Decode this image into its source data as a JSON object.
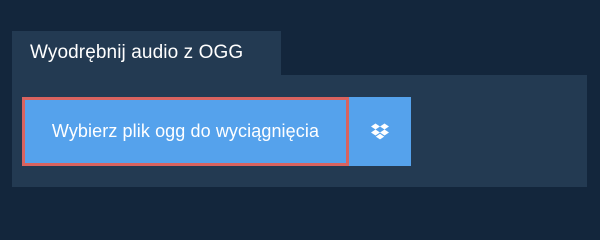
{
  "tab": {
    "label": "Wyodrębnij audio z OGG"
  },
  "actions": {
    "pick_file_label": "Wybierz plik ogg do wyciągnięcia",
    "dropbox_icon": "dropbox-icon"
  },
  "colors": {
    "background": "#13263c",
    "panel": "#233a52",
    "button": "#55a2ec",
    "focus_outline": "#d9635f",
    "text": "#ffffff"
  }
}
